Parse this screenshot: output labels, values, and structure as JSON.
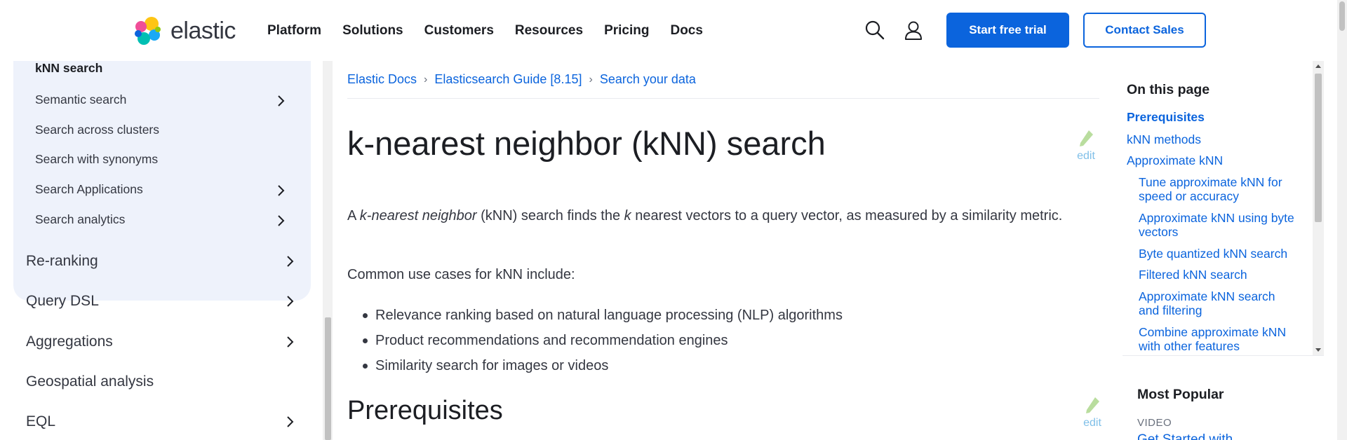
{
  "header": {
    "logo_text": "elastic",
    "nav": [
      "Platform",
      "Solutions",
      "Customers",
      "Resources",
      "Pricing",
      "Docs"
    ],
    "search_icon": "search-icon",
    "user_icon": "user-icon",
    "cta_primary": "Start free trial",
    "cta_secondary": "Contact Sales",
    "colors": {
      "brand_blue": "#0b64dd",
      "text_dark": "#1c1e23"
    }
  },
  "sidebar": {
    "sub_items": [
      {
        "label": "kNN search",
        "bold": true,
        "has_chevron": false
      },
      {
        "label": "Semantic search",
        "has_chevron": true
      },
      {
        "label": "Search across clusters",
        "has_chevron": false
      },
      {
        "label": "Search with synonyms",
        "has_chevron": false
      },
      {
        "label": "Search Applications",
        "has_chevron": true
      },
      {
        "label": "Search analytics",
        "has_chevron": true
      }
    ],
    "top_items": [
      {
        "label": "Re-ranking",
        "has_chevron": true
      },
      {
        "label": "Query DSL",
        "has_chevron": true
      },
      {
        "label": "Aggregations",
        "has_chevron": true
      },
      {
        "label": "Geospatial analysis",
        "has_chevron": false
      },
      {
        "label": "EQL",
        "has_chevron": true
      }
    ],
    "colors": {
      "panel_bg": "#eef2fb"
    }
  },
  "breadcrumbs": [
    "Elastic Docs",
    "Elasticsearch Guide [8.15]",
    "Search your data"
  ],
  "breadcrumb_separator": "›",
  "article": {
    "title": "k-nearest neighbor (kNN) search",
    "edit_label": "edit",
    "intro_a": "A ",
    "intro_em": "k-nearest neighbor",
    "intro_b": " (kNN) search finds the ",
    "intro_k": "k",
    "intro_c": " nearest vectors to a query vector, as measured by a similarity metric.",
    "use_cases_intro": "Common use cases for kNN include:",
    "use_cases": [
      "Relevance ranking based on natural language processing (NLP) algorithms",
      "Product recommendations and recommendation engines",
      "Similarity search for images or videos"
    ],
    "section_heading": "Prerequisites"
  },
  "toc": {
    "title": "On this page",
    "links": [
      {
        "label": "Prerequisites",
        "active": true,
        "indent": false
      },
      {
        "label": "kNN methods",
        "indent": false
      },
      {
        "label": "Approximate kNN",
        "indent": false
      },
      {
        "label": "Tune approximate kNN for speed or accuracy",
        "indent": true
      },
      {
        "label": "Approximate kNN using byte vectors",
        "indent": true
      },
      {
        "label": "Byte quantized kNN search",
        "indent": true
      },
      {
        "label": "Filtered kNN search",
        "indent": true
      },
      {
        "label": "Approximate kNN search and filtering",
        "indent": true
      },
      {
        "label": "Combine approximate kNN with other features",
        "indent": true
      }
    ]
  },
  "most_popular": {
    "title": "Most Popular",
    "tag": "VIDEO",
    "link": "Get Started with"
  }
}
